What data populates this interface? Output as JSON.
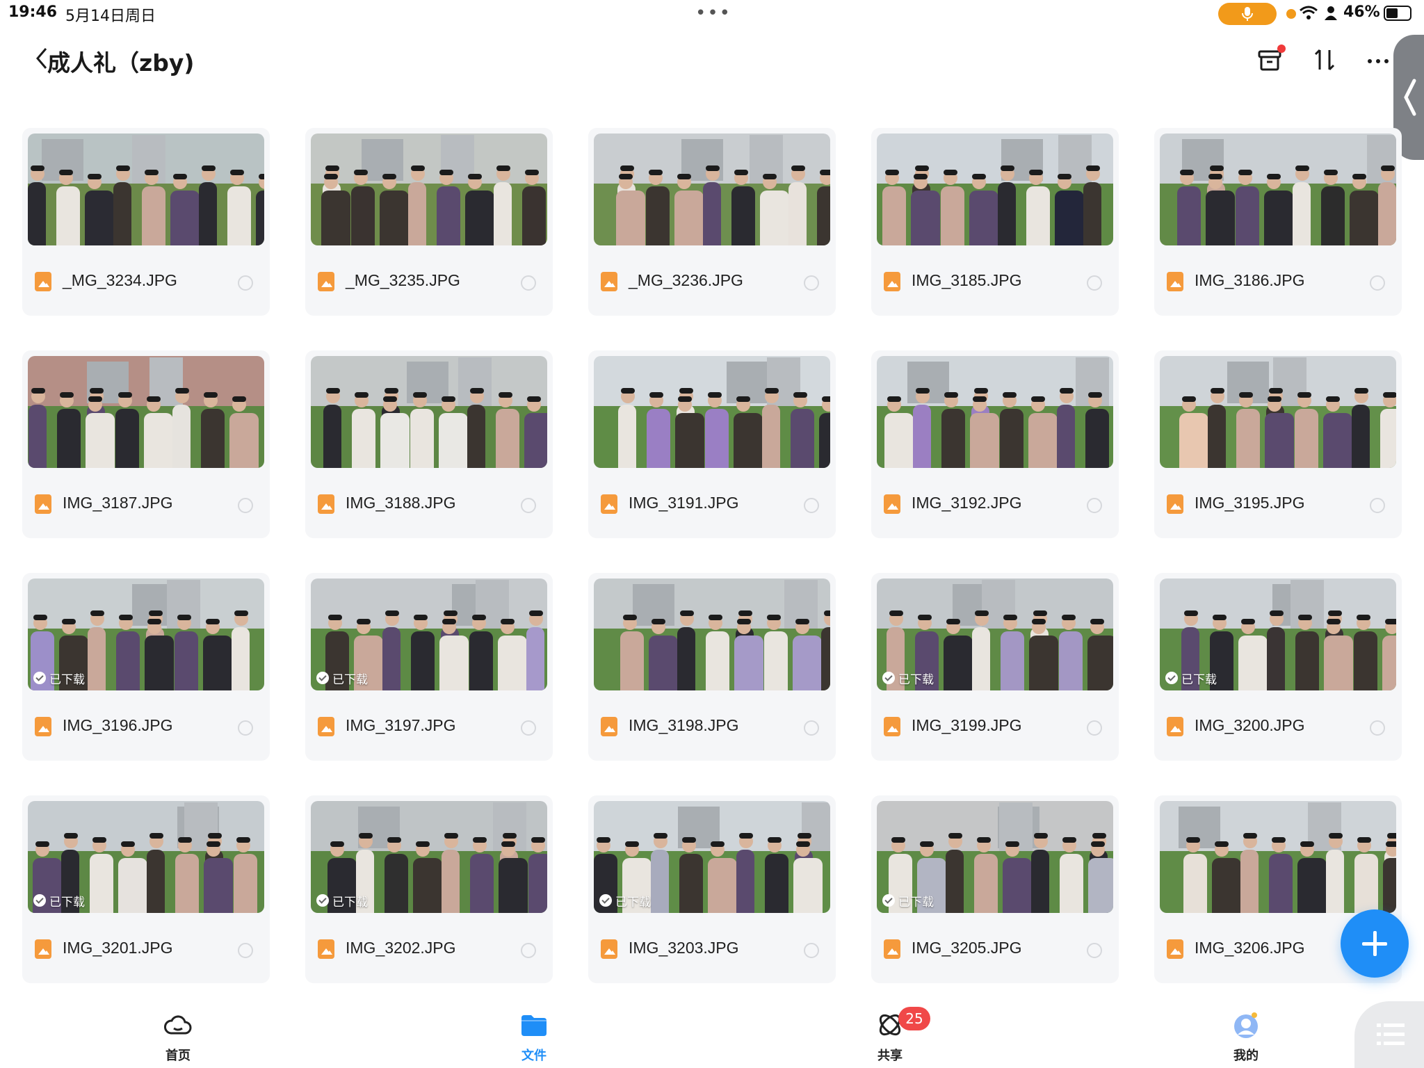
{
  "status_bar": {
    "time": "19:46",
    "date": "5月14日周日",
    "battery": "46%"
  },
  "header": {
    "title": "成人礼（zby)"
  },
  "files": [
    {
      "name": "_MG_3234.JPG",
      "downloaded": false,
      "palette": [
        "#b9c3c4",
        "#6c8a4a",
        "#2b2b33"
      ]
    },
    {
      "name": "_MG_3235.JPG",
      "downloaded": false,
      "palette": [
        "#c3c7c4",
        "#6f8d4b",
        "#3a3330"
      ]
    },
    {
      "name": "_MG_3236.JPG",
      "downloaded": false,
      "palette": [
        "#c9cdd0",
        "#6e8f4f",
        "#e8e2dc"
      ]
    },
    {
      "name": "IMG_3185.JPG",
      "downloaded": false,
      "palette": [
        "#cfd5da",
        "#5f8a45",
        "#23263a"
      ]
    },
    {
      "name": "IMG_3186.JPG",
      "downloaded": false,
      "palette": [
        "#cbd0d4",
        "#628a47",
        "#2c2c2c"
      ]
    },
    {
      "name": "IMG_3187.JPG",
      "downloaded": false,
      "palette": [
        "#b58f86",
        "#5d8744",
        "#e6e3de"
      ]
    },
    {
      "name": "IMG_3188.JPG",
      "downloaded": false,
      "palette": [
        "#c4c8c8",
        "#5d8644",
        "#e9e8e4"
      ]
    },
    {
      "name": "IMG_3191.JPG",
      "downloaded": false,
      "palette": [
        "#d3d9dd",
        "#5f8c46",
        "#9a7fc4"
      ]
    },
    {
      "name": "IMG_3192.JPG",
      "downloaded": false,
      "palette": [
        "#d0d6da",
        "#5e8b45",
        "#9b7fc2"
      ]
    },
    {
      "name": "IMG_3195.JPG",
      "downloaded": false,
      "palette": [
        "#cfd4d8",
        "#63904a",
        "#e8c7b0"
      ]
    },
    {
      "name": "IMG_3196.JPG",
      "downloaded": true,
      "palette": [
        "#c9cfd1",
        "#5f8a46",
        "#9c8fc9"
      ]
    },
    {
      "name": "IMG_3197.JPG",
      "downloaded": true,
      "palette": [
        "#c6cacd",
        "#5d8a45",
        "#a699cb"
      ]
    },
    {
      "name": "IMG_3198.JPG",
      "downloaded": false,
      "palette": [
        "#c4c9cb",
        "#608b47",
        "#a59ac8"
      ]
    },
    {
      "name": "IMG_3199.JPG",
      "downloaded": true,
      "palette": [
        "#c3c8cb",
        "#5f8a46",
        "#a397c4"
      ]
    },
    {
      "name": "IMG_3200.JPG",
      "downloaded": true,
      "palette": [
        "#cdd2d6",
        "#5f8b47",
        "#3a3434"
      ]
    },
    {
      "name": "IMG_3201.JPG",
      "downloaded": true,
      "palette": [
        "#c6ccd0",
        "#5d8845",
        "#e6e2de"
      ]
    },
    {
      "name": "IMG_3202.JPG",
      "downloaded": true,
      "palette": [
        "#bfc4c6",
        "#5c8744",
        "#2f2f2f"
      ]
    },
    {
      "name": "IMG_3203.JPG",
      "downloaded": true,
      "palette": [
        "#cfd5d9",
        "#5f8d47",
        "#a8abbd"
      ]
    },
    {
      "name": "IMG_3205.JPG",
      "downloaded": true,
      "palette": [
        "#c5c6c7",
        "#5e8b46",
        "#b2b5c3"
      ]
    },
    {
      "name": "IMG_3206.JPG",
      "downloaded": false,
      "palette": [
        "#cfd4d8",
        "#608c47",
        "#e7e0d8"
      ]
    }
  ],
  "download_badge_label": "已下载",
  "bottom_nav": [
    {
      "label": "首页",
      "icon": "cloud-icon"
    },
    {
      "label": "文件",
      "icon": "folder-icon",
      "active": true
    },
    {
      "label": "共享",
      "icon": "share-icon",
      "badge": "25"
    },
    {
      "label": "我的",
      "icon": "profile-icon"
    }
  ],
  "colors": {
    "accent": "#1f8ef7",
    "badge_red": "#f04848",
    "file_icon_orange": "#f59a3c",
    "card_background": "#f5f6f8"
  }
}
